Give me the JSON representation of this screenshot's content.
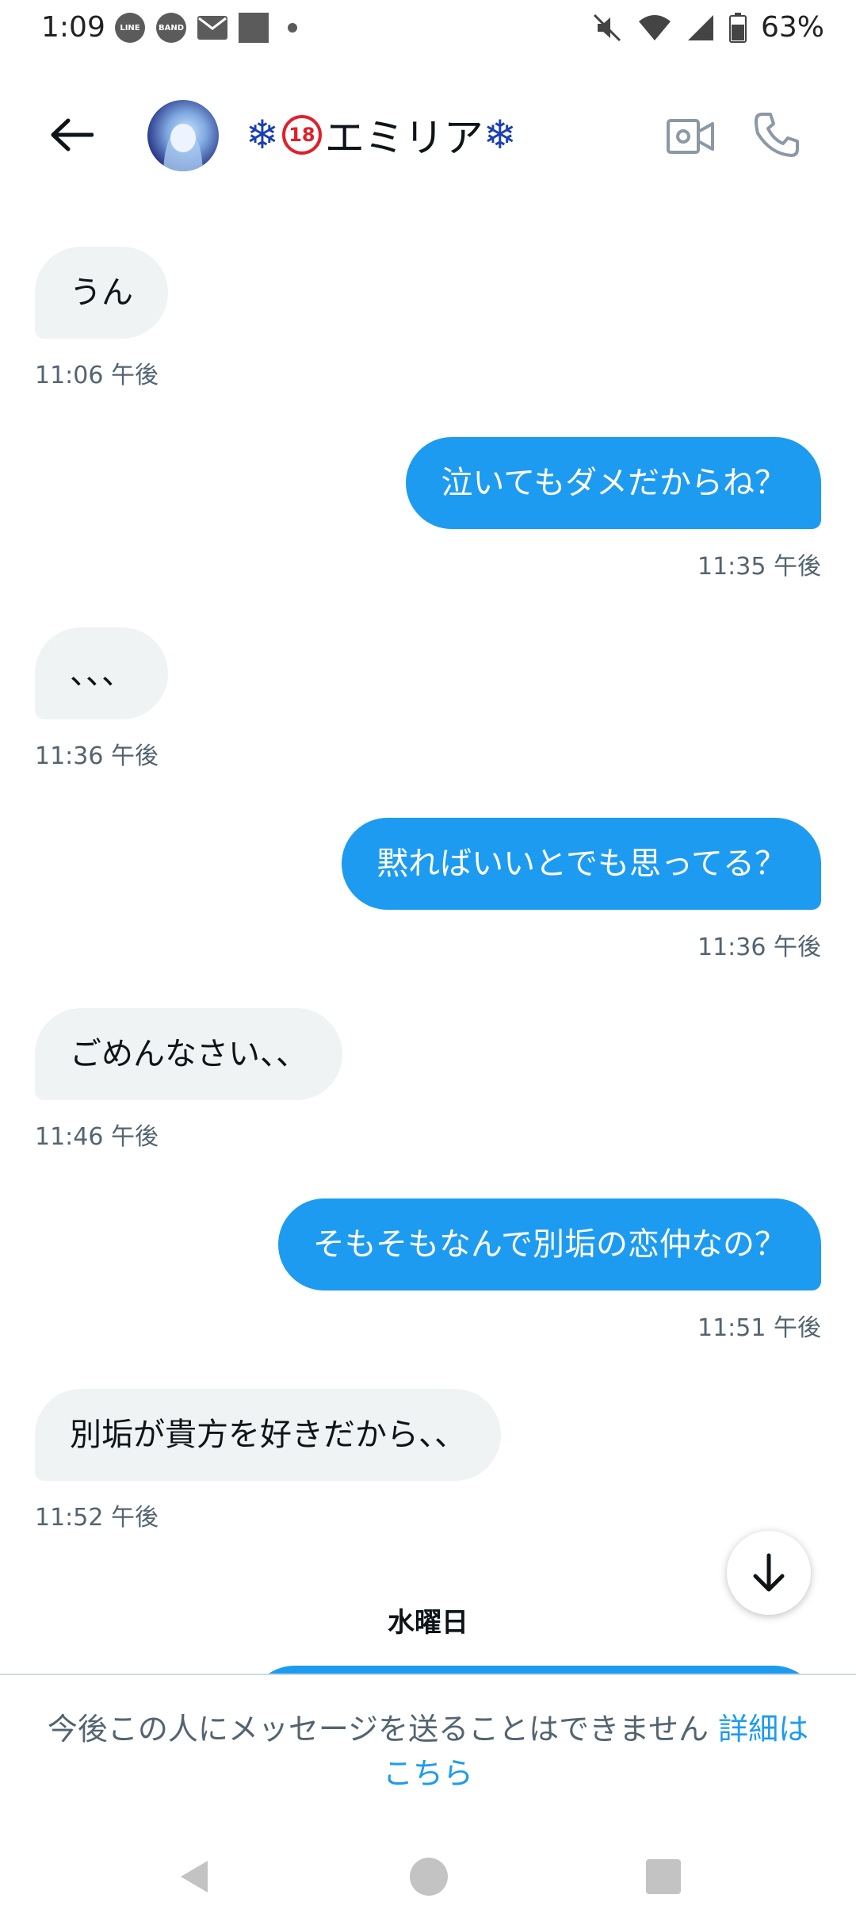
{
  "status_bar": {
    "time": "1:09",
    "left_icons": [
      "line-icon",
      "band-icon",
      "mail-icon",
      "square-icon",
      "dot-icon"
    ],
    "line_badge": "LINE",
    "band_badge": "BAND",
    "battery": "63%",
    "right_icons": [
      "mute-icon",
      "wifi-icon",
      "signal-icon",
      "battery-icon"
    ]
  },
  "header": {
    "name_prefix": "❄",
    "name_badge": "18",
    "name_text": "エミリア",
    "name_suffix": "❄"
  },
  "messages": [
    {
      "side": "recv",
      "text": "うん",
      "time": "11:06 午後"
    },
    {
      "side": "sent",
      "text": "泣いてもダメだからね？",
      "time": "11:35 午後"
    },
    {
      "side": "recv",
      "text": "、、、",
      "time": "11:36 午後"
    },
    {
      "side": "sent",
      "text": "黙ればいいとでも思ってる？",
      "time": "11:36 午後"
    },
    {
      "side": "recv",
      "text": "ごめんなさい、、",
      "time": "11:46 午後"
    },
    {
      "side": "sent",
      "text": "そもそもなんで別垢の恋仲なの？",
      "time": "11:51 午後"
    },
    {
      "side": "recv",
      "text": "別垢が貴方を好きだから、、",
      "time": "11:52 午後"
    }
  ],
  "day_separator": "水曜日",
  "footer": {
    "notice": "今後この人にメッセージを送ることはできません",
    "link": "詳細はこちら"
  },
  "colors": {
    "accent": "#1d9bf0",
    "received_bubble": "#eff3f4",
    "timestamp": "#536471"
  }
}
